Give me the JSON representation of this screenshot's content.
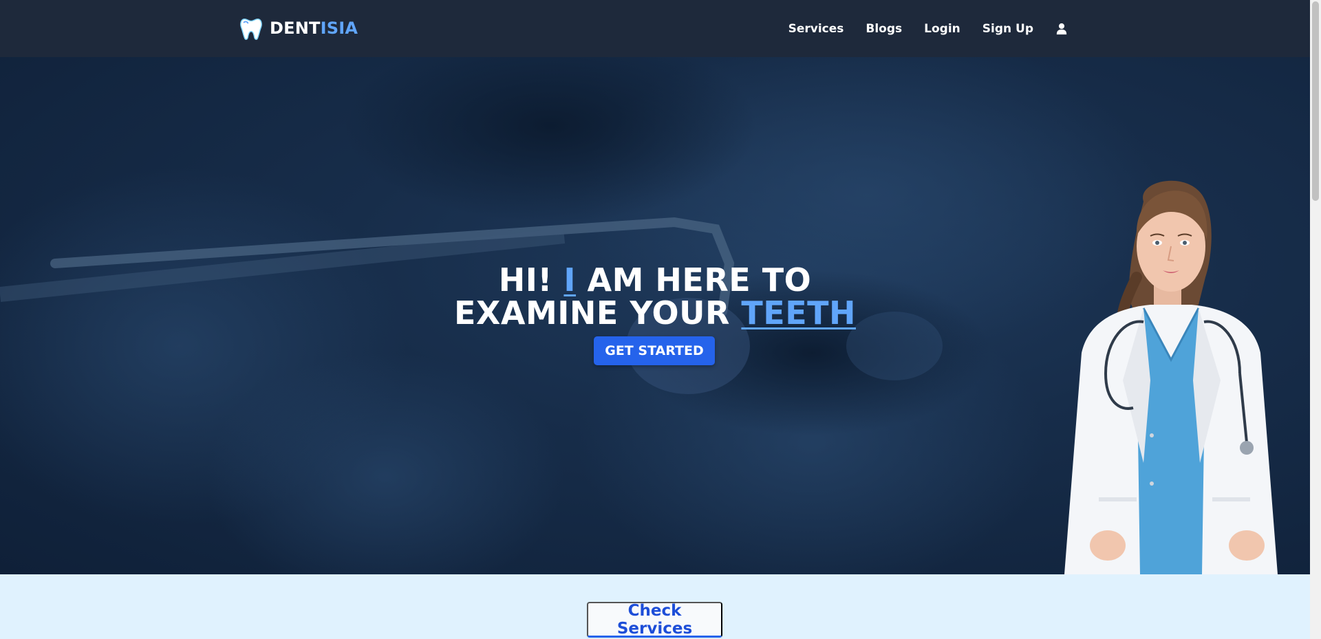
{
  "brand": {
    "name_primary": "DENT",
    "name_accent": "ISIA",
    "icon": "tooth-icon"
  },
  "nav": {
    "items": [
      {
        "label": "Services"
      },
      {
        "label": "Blogs"
      },
      {
        "label": "Login"
      },
      {
        "label": "Sign Up"
      }
    ],
    "user_icon": "user-icon"
  },
  "hero": {
    "line1_a": "HI! ",
    "line1_hl": "I",
    "line1_b": " AM HERE TO",
    "line2_a": "EXAMINE YOUR ",
    "line2_hl": "TEETH",
    "cta_label": "GET STARTED"
  },
  "services": {
    "button_label": "Check Services"
  },
  "colors": {
    "navbar": "#1e293b",
    "accent": "#60a5fa",
    "primary_button": "#2563eb",
    "section_bg": "#e0f2fe"
  }
}
